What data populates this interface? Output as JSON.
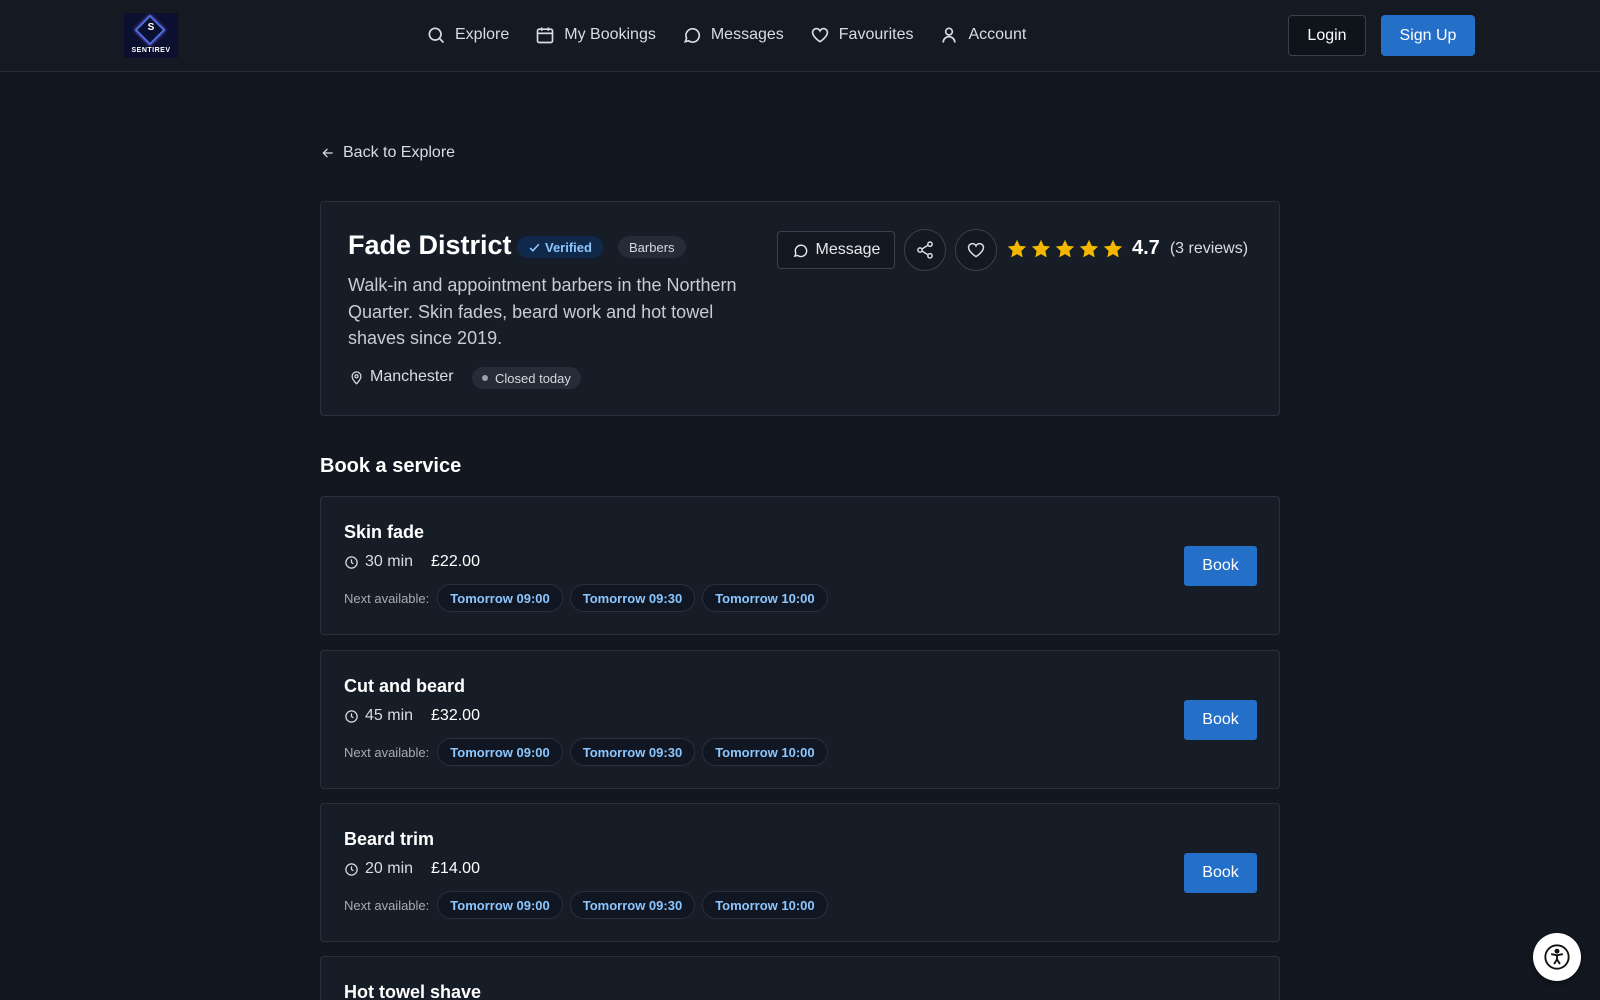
{
  "brand": {
    "logo_letter": "S",
    "logo_word": "SENTIREV"
  },
  "nav": {
    "items": [
      {
        "label": "Explore",
        "icon": "search-icon"
      },
      {
        "label": "My Bookings",
        "icon": "calendar-icon"
      },
      {
        "label": "Messages",
        "icon": "chat-bubble-icon"
      },
      {
        "label": "Favourites",
        "icon": "heart-icon"
      },
      {
        "label": "Account",
        "icon": "user-icon"
      }
    ],
    "login_label": "Login",
    "signup_label": "Sign Up"
  },
  "back_label": "Back to Explore",
  "business": {
    "name": "Fade District",
    "verified_label": "Verified",
    "category": "Barbers",
    "description": "Walk-in and appointment barbers in the Northern Quarter. Skin fades, beard work and hot towel shaves since 2019.",
    "location": "Manchester",
    "status": "Closed today",
    "message_label": "Message",
    "rating": "4.7",
    "stars": 5,
    "review_count": "(3 reviews)"
  },
  "services_title": "Book a service",
  "services": [
    {
      "name": "Skin fade",
      "duration": "30 min",
      "price": "£22.00",
      "next_label": "Next available:",
      "slots": [
        "Tomorrow 09:00",
        "Tomorrow 09:30",
        "Tomorrow 10:00"
      ],
      "book_label": "Book"
    },
    {
      "name": "Cut and beard",
      "duration": "45 min",
      "price": "£32.00",
      "next_label": "Next available:",
      "slots": [
        "Tomorrow 09:00",
        "Tomorrow 09:30",
        "Tomorrow 10:00"
      ],
      "book_label": "Book"
    },
    {
      "name": "Beard trim",
      "duration": "20 min",
      "price": "£14.00",
      "next_label": "Next available:",
      "slots": [
        "Tomorrow 09:00",
        "Tomorrow 09:30",
        "Tomorrow 10:00"
      ],
      "book_label": "Book"
    },
    {
      "name": "Hot towel shave"
    }
  ],
  "colors": {
    "accent": "#2470c9",
    "star": "#f5b800",
    "slot_text": "#8cc6ff",
    "background": "#121720"
  }
}
